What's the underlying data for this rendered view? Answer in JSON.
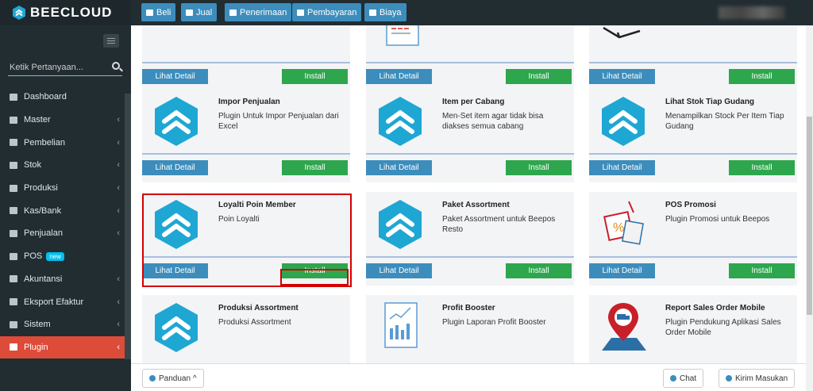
{
  "app": {
    "brand": "BEECLOUD"
  },
  "topnav": [
    {
      "label": "Beli"
    },
    {
      "label": "Jual"
    },
    {
      "label": "Penerimaan"
    },
    {
      "label": "Pembayaran"
    },
    {
      "label": "Biaya"
    }
  ],
  "sidebar": {
    "search_placeholder": "Ketik Pertanyaan...",
    "items": [
      {
        "label": "Dashboard",
        "icon": "home-icon"
      },
      {
        "label": "Master",
        "icon": "database-icon"
      },
      {
        "label": "Pembelian",
        "icon": "cart-icon"
      },
      {
        "label": "Stok",
        "icon": "box-icon"
      },
      {
        "label": "Produksi",
        "icon": "factory-icon"
      },
      {
        "label": "Kas/Bank",
        "icon": "money-icon"
      },
      {
        "label": "Penjualan",
        "icon": "cart-icon"
      },
      {
        "label": "POS",
        "icon": "monitor-icon",
        "badge": "new"
      },
      {
        "label": "Akuntansi",
        "icon": "chart-icon"
      },
      {
        "label": "Eksport Efaktur",
        "icon": "export-icon"
      },
      {
        "label": "Sistem",
        "icon": "gears-icon"
      },
      {
        "label": "Plugin",
        "icon": "puzzle-icon",
        "active": true
      }
    ]
  },
  "buttons": {
    "detail": "Lihat Detail",
    "install": "Install"
  },
  "cards": [
    {
      "title": "",
      "desc": "",
      "icon": "document-icon"
    },
    {
      "title": "",
      "desc": "",
      "icon": ""
    },
    {
      "title": "",
      "desc": "",
      "icon": "hand-icon"
    },
    {
      "title": "Impor Penjualan",
      "desc": "Plugin Untuk Impor Penjualan dari Excel",
      "icon": "beecloud-hex-icon"
    },
    {
      "title": "Item per Cabang",
      "desc": "Men-Set item agar tidak bisa diakses semua cabang",
      "icon": "beecloud-hex-icon"
    },
    {
      "title": "Lihat Stok Tiap Gudang",
      "desc": "Menampilkan Stock Per Item Tiap Gudang",
      "icon": "beecloud-hex-icon"
    },
    {
      "title": "Loyalti Poin Member",
      "desc": "Poin Loyalti",
      "icon": "beecloud-hex-icon"
    },
    {
      "title": "Paket Assortment",
      "desc": "Paket Assortment untuk Beepos Resto",
      "icon": "beecloud-hex-icon"
    },
    {
      "title": "POS Promosi",
      "desc": "Plugin Promosi untuk Beepos",
      "icon": "promo-tag-icon"
    },
    {
      "title": "Produksi Assortment",
      "desc": "Produksi Assortment",
      "icon": "beecloud-hex-icon"
    },
    {
      "title": "Profit Booster",
      "desc": "Plugin Laporan Profit Booster",
      "icon": "report-chart-icon"
    },
    {
      "title": "Report Sales Order Mobile",
      "desc": "Plugin Pendukung Aplikasi Sales Order Mobile",
      "icon": "map-truck-icon"
    }
  ],
  "footer": {
    "guide": "Panduan",
    "chat": "Chat",
    "feedback": "Kirim Masukan"
  },
  "colors": {
    "primary": "#3c8dbc",
    "success": "#2ea64e",
    "active": "#dd4b39",
    "highlight": "#d40000",
    "hex_icon": "#1ea7d3"
  }
}
